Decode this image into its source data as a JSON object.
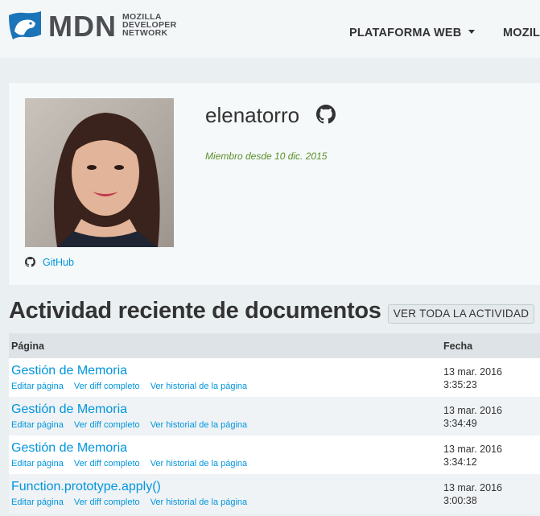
{
  "header": {
    "logo_main": "MDN",
    "logo_sub": [
      "MOZILLA",
      "DEVELOPER",
      "NETWORK"
    ],
    "nav": [
      {
        "label": "PLATAFORMA WEB",
        "has_caret": true
      },
      {
        "label": "MOZILL",
        "has_caret": false
      }
    ]
  },
  "profile": {
    "username": "elenatorro",
    "member_since": "Miembro desde 10 dic. 2015",
    "github_label": "GitHub"
  },
  "activity": {
    "title": "Actividad reciente de documentos",
    "view_all_label": "VER TODA LA ACTIVIDAD",
    "columns": {
      "page": "Página",
      "date": "Fecha"
    },
    "rows": [
      {
        "title": "Gestión de Memoria",
        "edit": "Editar página",
        "diff": "Ver diff completo",
        "history": "Ver historial de la página",
        "date": "13 mar. 2016",
        "time": "3:35:23"
      },
      {
        "title": "Gestión de Memoria",
        "edit": "Editar página",
        "diff": "Ver diff completo",
        "history": "Ver historial de la página",
        "date": "13 mar. 2016",
        "time": "3:34:49"
      },
      {
        "title": "Gestión de Memoria",
        "edit": "Editar página",
        "diff": "Ver diff completo",
        "history": "Ver historial de la página",
        "date": "13 mar. 2016",
        "time": "3:34:12"
      },
      {
        "title": "Function.prototype.apply()",
        "edit": "Editar página",
        "diff": "Ver diff completo",
        "history": "Ver historial de la página",
        "date": "13 mar. 2016",
        "time": "3:00:38"
      }
    ]
  },
  "colors": {
    "link": "#0095dd",
    "member_since": "#5a8f29",
    "logo": "#4d4e53",
    "logo_mark": "#1b74b8"
  },
  "icons": [
    "mdn-dino-logo-icon",
    "caret-down-icon",
    "github-icon",
    "avatar-photo"
  ]
}
